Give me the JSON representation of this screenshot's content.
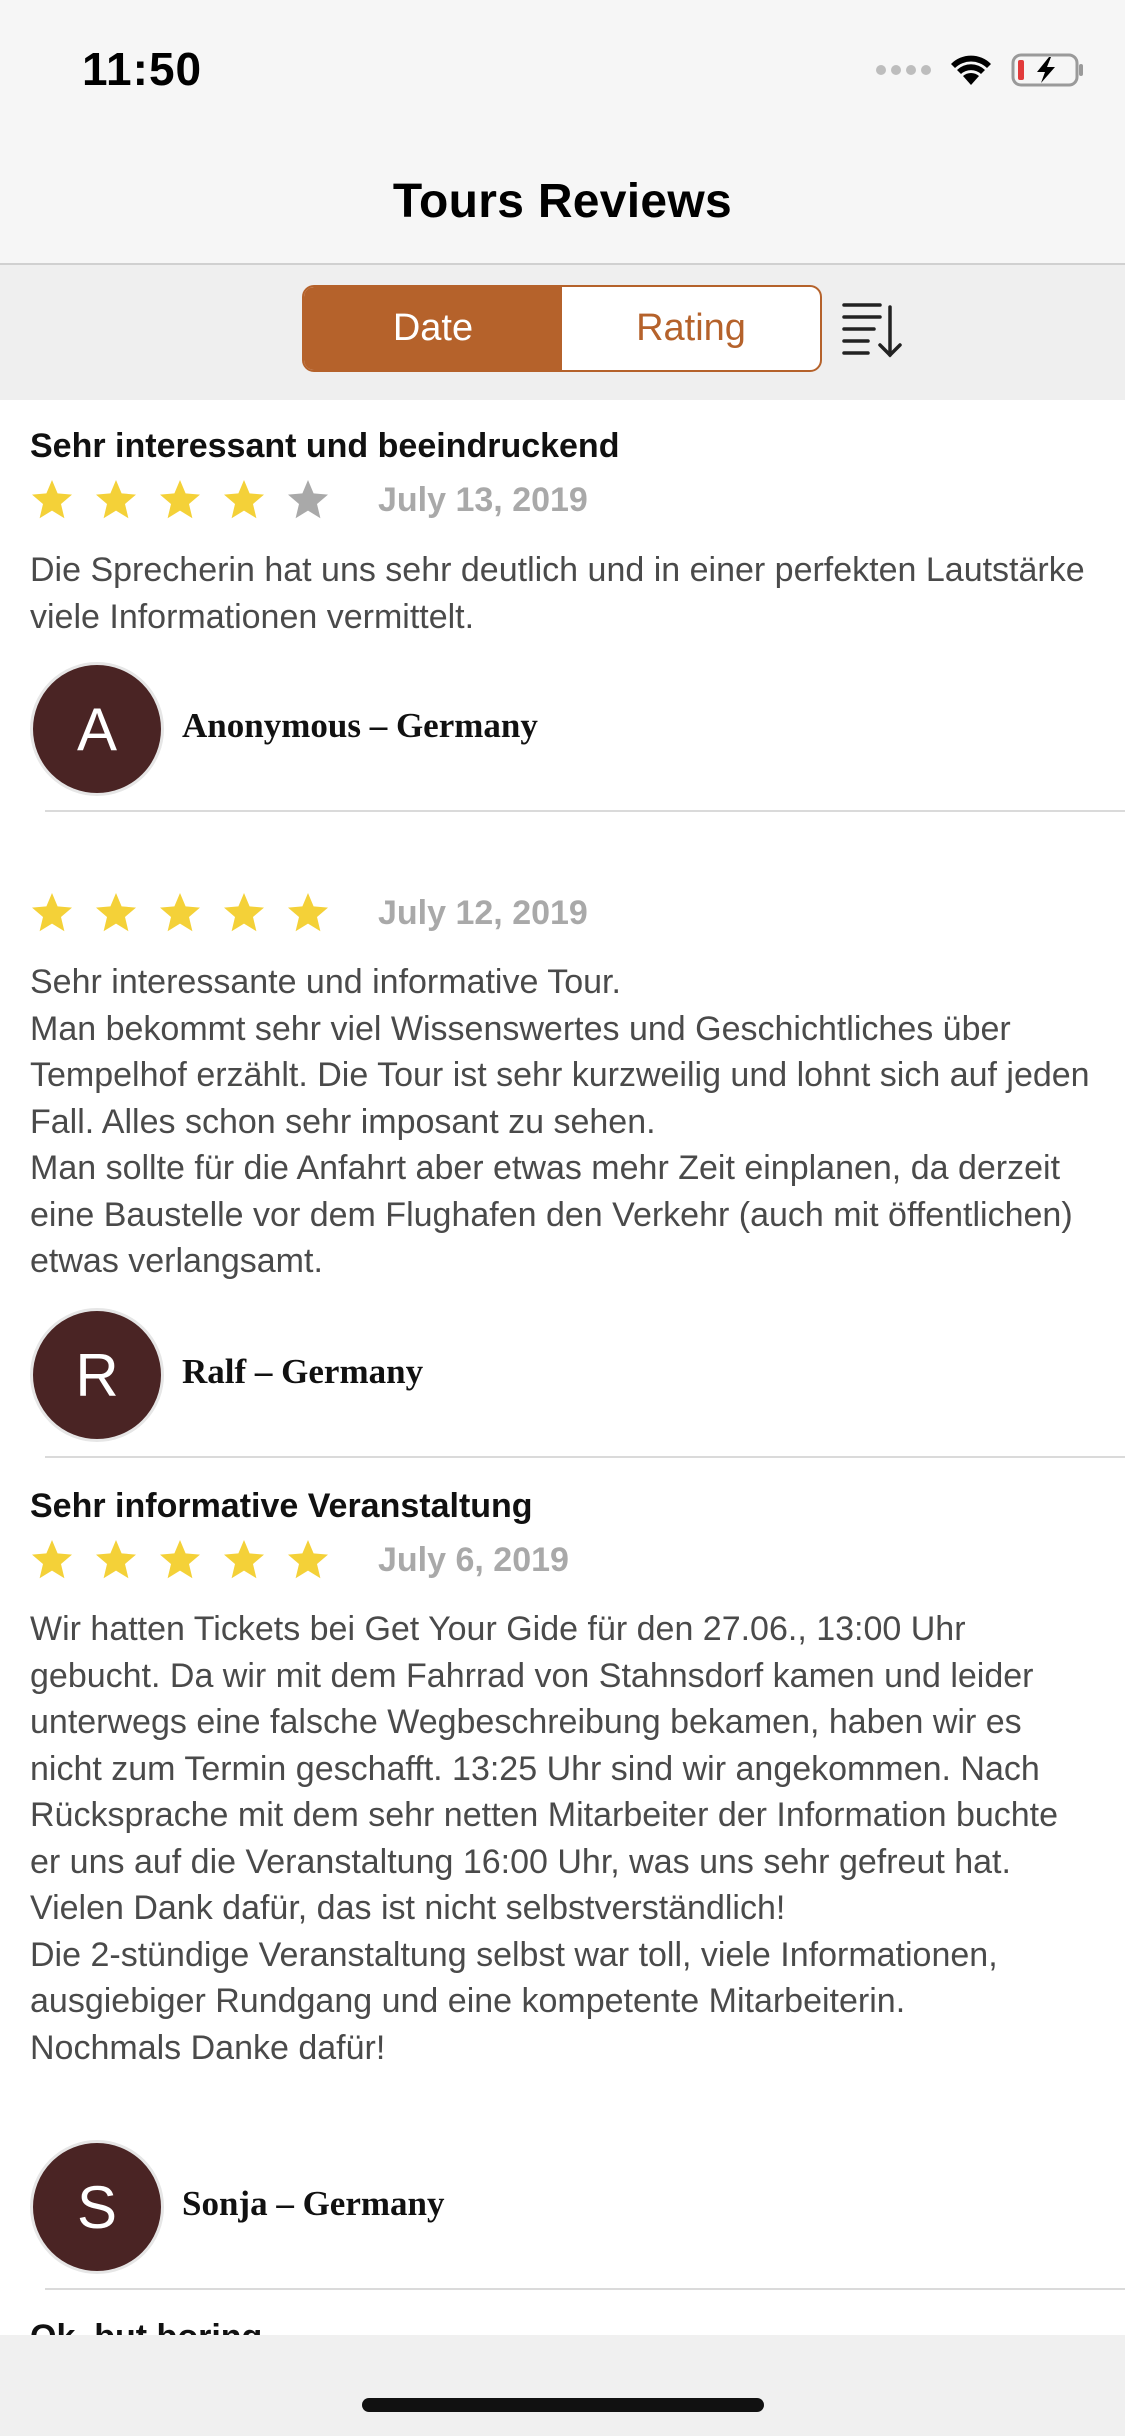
{
  "status_bar": {
    "time": "11:50"
  },
  "nav": {
    "title": "Tours Reviews"
  },
  "segments": {
    "date_label": "Date",
    "rating_label": "Rating",
    "selected": "Date"
  },
  "colors": {
    "accent": "#b5622b",
    "star": "#f4d138",
    "star_empty": "#a9a9a9",
    "avatar": "#4a2424"
  },
  "reviews": [
    {
      "title": "Sehr interessant und beeindruckend",
      "rating": 4,
      "date": "July 13, 2019",
      "body": "Die Sprecherin hat uns sehr deutlich und in einer perfekten Lautstärke viele Informationen vermittelt.",
      "initial": "A",
      "author": "Anonymous – Germany"
    },
    {
      "title": "",
      "rating": 5,
      "date": "July 12, 2019",
      "body": "Sehr interessante und informative Tour.\nMan bekommt sehr viel Wissenswertes und Geschichtliches über Tempelhof erzählt. Die Tour ist sehr kurzweilig und lohnt sich auf jeden Fall. Alles schon sehr imposant zu sehen.\nMan sollte für die Anfahrt aber etwas mehr Zeit einplanen, da derzeit eine Baustelle vor dem Flughafen den Verkehr (auch mit öffentlichen) etwas verlangsamt.",
      "initial": "R",
      "author": "Ralf – Germany"
    },
    {
      "title": "Sehr informative Veranstaltung",
      "rating": 5,
      "date": "July 6, 2019",
      "body": "Wir hatten Tickets bei Get Your Gide für den 27.06., 13:00 Uhr gebucht. Da wir mit dem Fahrrad von Stahnsdorf kamen und leider unterwegs eine falsche Wegbeschreibung bekamen, haben wir es nicht zum Termin geschafft. 13:25 Uhr sind wir angekommen. Nach Rücksprache mit dem sehr netten Mitarbeiter der Information buchte er uns auf die Veranstaltung 16:00 Uhr, was uns sehr gefreut hat. Vielen Dank dafür, das ist nicht selbstverständlich!\nDie 2-stündige Veranstaltung selbst war toll, viele Informationen, ausgiebiger Rundgang und eine kompetente Mitarbeiterin.\nNochmals Danke dafür!",
      "initial": "S",
      "author": "Sonja – Germany"
    },
    {
      "title": "Ok, but boring"
    }
  ]
}
